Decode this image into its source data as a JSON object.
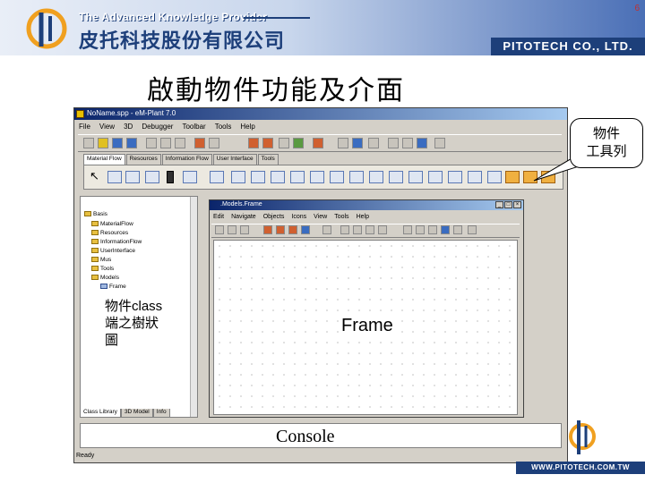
{
  "header": {
    "company_en": "The Advanced Knowledge Provider",
    "company_zh": "皮托科技股份有限公司",
    "company_short": "PITOTECH CO., LTD.",
    "page_number": "6"
  },
  "slide": {
    "title": "啟動物件功能及介面"
  },
  "app": {
    "title": "NoName.spp - eM-Plant 7.0",
    "menu": [
      "File",
      "View",
      "3D",
      "Debugger",
      "Toolbar",
      "Tools",
      "Help"
    ],
    "object_tabs": [
      "Material Flow",
      "Resources",
      "Information Flow",
      "User Interface",
      "Tools"
    ],
    "tree_items": [
      "Basis",
      "MaterialFlow",
      "Resources",
      "InformationFlow",
      "UserInterface",
      "Mus",
      "Tools",
      "Models",
      "Frame"
    ],
    "tree_tabs": [
      "Class Library",
      "3D Model",
      "Info"
    ],
    "status": "Ready"
  },
  "frame_window": {
    "title": ".Models.Frame",
    "menu": [
      "Edit",
      "Navigate",
      "Objects",
      "Icons",
      "View",
      "Tools",
      "Help"
    ]
  },
  "annotations": {
    "toolbar_callout": [
      "物件",
      "工具列"
    ],
    "tree_label": [
      "物件class",
      "端之樹狀",
      "圖"
    ],
    "frame_label": "Frame",
    "console_label": "Console"
  },
  "footer": {
    "url": "WWW.PITOTECH.COM.TW"
  },
  "colors": {
    "brand_blue": "#1d3f7a",
    "titlebar": "#0a246a",
    "logo_orange": "#f0a020"
  }
}
